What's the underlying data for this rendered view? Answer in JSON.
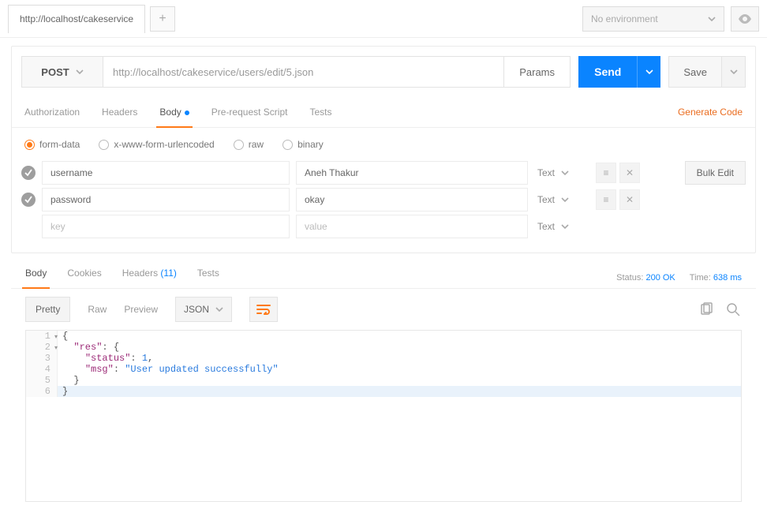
{
  "top": {
    "tab_label": "http://localhost/cakeservice",
    "env_label": "No environment"
  },
  "request": {
    "method": "POST",
    "url": "http://localhost/cakeservice/users/edit/5.json",
    "params_label": "Params",
    "send_label": "Send",
    "save_label": "Save",
    "tabs": {
      "authorization": "Authorization",
      "headers": "Headers",
      "body": "Body",
      "prerequest": "Pre-request Script",
      "tests": "Tests"
    },
    "generate_code": "Generate Code",
    "body_types": {
      "formdata": "form-data",
      "urlencoded": "x-www-form-urlencoded",
      "raw": "raw",
      "binary": "binary"
    },
    "kv": {
      "bulk_edit": "Bulk Edit",
      "type_label": "Text",
      "key_placeholder": "key",
      "value_placeholder": "value",
      "rows": [
        {
          "key": "username",
          "value": "Aneh Thakur"
        },
        {
          "key": "password",
          "value": "okay"
        }
      ]
    }
  },
  "response": {
    "tabs": {
      "body": "Body",
      "cookies": "Cookies",
      "headers": "Headers",
      "headers_count": "(11)",
      "tests": "Tests"
    },
    "status_label": "Status:",
    "status_value": "200 OK",
    "time_label": "Time:",
    "time_value": "638 ms",
    "view": {
      "pretty": "Pretty",
      "raw": "Raw",
      "preview": "Preview",
      "format": "JSON"
    },
    "json_tokens": {
      "res": "\"res\"",
      "status": "\"status\"",
      "status_val": "1",
      "msg": "\"msg\"",
      "msg_val": "\"User updated successfully\""
    }
  },
  "chart_data": null
}
